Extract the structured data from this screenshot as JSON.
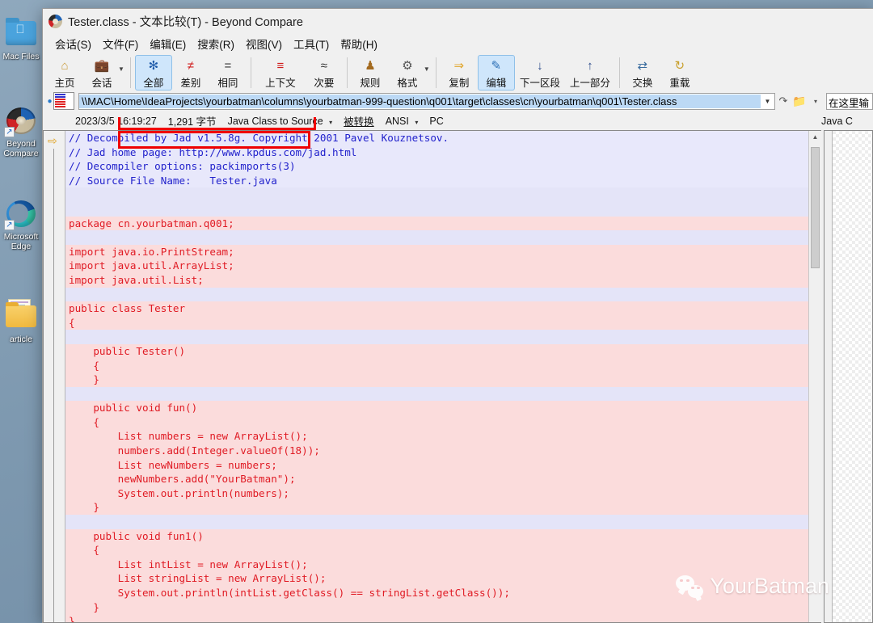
{
  "desktop": {
    "icons": [
      {
        "name": "mac-files-folder",
        "label": "Mac Files",
        "glyph": "folder-apple-icon"
      },
      {
        "name": "beyond-compare-shortcut",
        "label": "Beyond Compare",
        "label_line1": "Beyond",
        "label_line2": "Compare",
        "glyph": "beyond-compare-icon"
      },
      {
        "name": "microsoft-edge-shortcut",
        "label": "Microsoft Edge",
        "label_line1": "Microsoft",
        "label_line2": "Edge",
        "glyph": "edge-icon"
      },
      {
        "name": "article-folder",
        "label": "article",
        "glyph": "folder-documents-icon"
      }
    ],
    "shortcut_arrow": "↗"
  },
  "window": {
    "title": "Tester.class - 文本比较(T) - Beyond Compare",
    "app_icon": "beyond-compare-icon"
  },
  "menubar": {
    "items": [
      {
        "name": "menu-session",
        "label": "会话(S)"
      },
      {
        "name": "menu-file",
        "label": "文件(F)"
      },
      {
        "name": "menu-edit",
        "label": "编辑(E)"
      },
      {
        "name": "menu-search",
        "label": "搜索(R)"
      },
      {
        "name": "menu-view",
        "label": "视图(V)"
      },
      {
        "name": "menu-tools",
        "label": "工具(T)"
      },
      {
        "name": "menu-help",
        "label": "帮助(H)"
      }
    ]
  },
  "toolbar": {
    "buttons": [
      {
        "name": "home",
        "label": "主页",
        "icon": "home-icon",
        "glyph": "⌂",
        "color": "#c99a3a",
        "active": false
      },
      {
        "name": "session",
        "label": "会话",
        "icon": "briefcase-icon",
        "glyph": "▮",
        "color": "#c99a3a",
        "active": false,
        "caret": true
      },
      {
        "name": "all",
        "label": "全部",
        "icon": "asterisk-icon",
        "glyph": "✻",
        "color": "#1a58a8",
        "active": true
      },
      {
        "name": "differences",
        "label": "差别",
        "icon": "not-equal-icon",
        "glyph": "≠",
        "color": "#d01c1c",
        "active": false
      },
      {
        "name": "same",
        "label": "相同",
        "icon": "equals-icon",
        "glyph": "=",
        "color": "#333333",
        "active": false
      },
      {
        "name": "context",
        "label": "上下文",
        "icon": "context-lines-icon",
        "glyph": "≡",
        "color": "#d01c1c",
        "active": false
      },
      {
        "name": "minor",
        "label": "次要",
        "icon": "approximately-equal-icon",
        "glyph": "≈",
        "color": "#333333",
        "active": false
      },
      {
        "name": "rules",
        "label": "规则",
        "icon": "rules-person-icon",
        "glyph": "♟",
        "color": "#a36a1f",
        "active": false
      },
      {
        "name": "format",
        "label": "格式",
        "icon": "format-gear-icon",
        "glyph": "⚙",
        "color": "#555555",
        "active": false,
        "caret": true
      },
      {
        "name": "copy",
        "label": "复制",
        "icon": "arrow-right-icon",
        "glyph": "⇒",
        "color": "#e0a326",
        "active": false
      },
      {
        "name": "edit",
        "label": "编辑",
        "icon": "edit-pencil-icon",
        "glyph": "✎",
        "color": "#2b6fb5",
        "active": true
      },
      {
        "name": "next-section",
        "label": "下一区段",
        "icon": "arrow-down-icon",
        "glyph": "↓",
        "color": "#2b4a8a",
        "active": false
      },
      {
        "name": "previous-section",
        "label": "上一部分",
        "icon": "arrow-up-icon",
        "glyph": "↑",
        "color": "#2b4a8a",
        "active": false
      },
      {
        "name": "swap",
        "label": "交换",
        "icon": "swap-icon",
        "glyph": "⇄",
        "color": "#3a6c9e",
        "active": false
      },
      {
        "name": "reload",
        "label": "重载",
        "icon": "reload-icon",
        "glyph": "↻",
        "color": "#c9a02c",
        "active": false
      }
    ],
    "separators_after": [
      "session",
      "same",
      "minor",
      "format",
      "previous-section"
    ]
  },
  "pathbar": {
    "path_value": "\\\\MAC\\Home\\IdeaProjects\\yourbatman\\columns\\yourbatman-999-question\\q001\\target\\classes\\cn\\yourbatman\\q001\\Tester.class",
    "dropdown_glyph": "⌄",
    "refresh_icon": "refresh-arrow-icon",
    "browse_icon": "open-folder-icon",
    "browse_caret": "▾",
    "right_field_value": "在这里输"
  },
  "infobar": {
    "timestamp": "2023/3/5 16:19:27",
    "size": "1,291 字节",
    "converter": "Java Class to Source",
    "converter_caret": "▾",
    "converted_state": "被转换",
    "encoding": "ANSI",
    "encoding_caret": "▾",
    "line_ending": "PC",
    "right_pane_label": "Java C"
  },
  "editor": {
    "gutter_marker": "⇨",
    "lines": [
      {
        "kind": "cmt",
        "text": "// Decompiled by Jad v1.5.8g. Copyright 2001 Pavel Kouznetsov."
      },
      {
        "kind": "cmt",
        "text": "// Jad home page: http://www.kpdus.com/jad.html"
      },
      {
        "kind": "cmt",
        "text": "// Decompiler options: packimports(3)"
      },
      {
        "kind": "cmt",
        "text": "// Source File Name:   Tester.java"
      },
      {
        "kind": "bl",
        "text": ""
      },
      {
        "kind": "bl",
        "text": ""
      },
      {
        "kind": "ch",
        "text": "package cn.yourbatman.q001;"
      },
      {
        "kind": "bl",
        "text": ""
      },
      {
        "kind": "ch",
        "text": "import java.io.PrintStream;"
      },
      {
        "kind": "ch",
        "text": "import java.util.ArrayList;"
      },
      {
        "kind": "ch",
        "text": "import java.util.List;"
      },
      {
        "kind": "bl",
        "text": ""
      },
      {
        "kind": "ch",
        "text": "public class Tester"
      },
      {
        "kind": "ch",
        "text": "{"
      },
      {
        "kind": "bl",
        "text": ""
      },
      {
        "kind": "ch",
        "text": "    public Tester()"
      },
      {
        "kind": "ch",
        "text": "    {"
      },
      {
        "kind": "ch",
        "text": "    }"
      },
      {
        "kind": "bl",
        "text": ""
      },
      {
        "kind": "ch",
        "text": "    public void fun()"
      },
      {
        "kind": "ch",
        "text": "    {"
      },
      {
        "kind": "ch",
        "text": "        List numbers = new ArrayList();"
      },
      {
        "kind": "ch",
        "text": "        numbers.add(Integer.valueOf(18));"
      },
      {
        "kind": "ch",
        "text": "        List newNumbers = numbers;"
      },
      {
        "kind": "ch",
        "text": "        newNumbers.add(\"YourBatman\");"
      },
      {
        "kind": "ch",
        "text": "        System.out.println(numbers);"
      },
      {
        "kind": "ch",
        "text": "    }"
      },
      {
        "kind": "bl",
        "text": ""
      },
      {
        "kind": "ch",
        "text": "    public void fun1()"
      },
      {
        "kind": "ch",
        "text": "    {"
      },
      {
        "kind": "ch",
        "text": "        List intList = new ArrayList();"
      },
      {
        "kind": "ch",
        "text": "        List stringList = new ArrayList();"
      },
      {
        "kind": "ch",
        "text": "        System.out.println(intList.getClass() == stringList.getClass());"
      },
      {
        "kind": "ch",
        "text": "    }"
      },
      {
        "kind": "ch",
        "text": "}"
      }
    ],
    "scrollbar": {
      "up_arrow": "▲",
      "down_arrow": "▼"
    }
  },
  "annotations": {
    "highlight_color": "#ef0000",
    "boxes": [
      {
        "name": "annotation-box-first-comment-line"
      },
      {
        "name": "annotation-box-info-segment"
      }
    ]
  },
  "watermark": {
    "text": "YourBatman",
    "icon": "wechat-icon"
  },
  "colors": {
    "changed_line_bg": "#fbdcdc",
    "changed_text": "#e01b24",
    "comment_bg": "#e8e8fb",
    "comment_text": "#2222cc",
    "blank_line_bg": "#e4e4f8",
    "active_toolbar_bg": "#cfe6fb",
    "selection_blue": "#bcd9f5"
  }
}
